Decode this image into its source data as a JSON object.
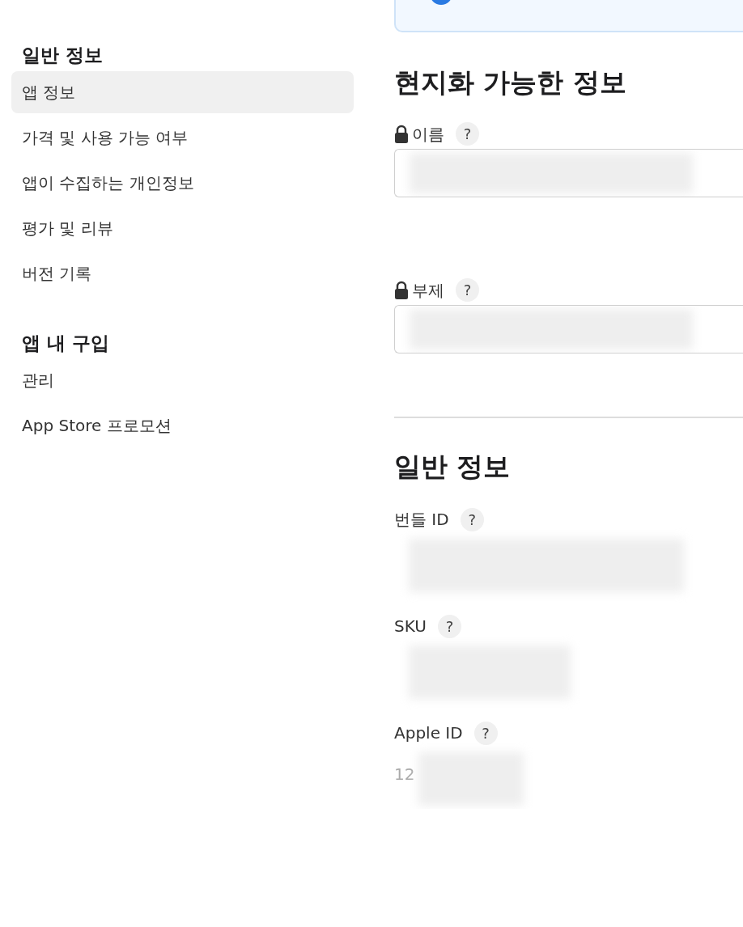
{
  "sidebar": {
    "sections": [
      {
        "heading": "일반 정보",
        "items": [
          {
            "label": "앱 정보",
            "selected": true
          },
          {
            "label": "가격 및 사용 가능 여부",
            "selected": false
          },
          {
            "label": "앱이 수집하는 개인정보",
            "selected": false
          },
          {
            "label": "평가 및 리뷰",
            "selected": false
          },
          {
            "label": "버전 기록",
            "selected": false
          }
        ]
      },
      {
        "heading": "앱 내 구입",
        "items": [
          {
            "label": "관리",
            "selected": false
          },
          {
            "label": "App Store 프로모션",
            "selected": false
          }
        ]
      }
    ]
  },
  "sections": [
    {
      "title": "현지화 가능한 정보",
      "fields": [
        {
          "label": "이름",
          "help": "?",
          "locked": true,
          "kind": "input",
          "redacted": true
        },
        {
          "label": "부제",
          "help": "?",
          "locked": true,
          "kind": "input",
          "redacted": true
        }
      ]
    },
    {
      "title": "일반 정보",
      "fields": [
        {
          "label": "번들 ID",
          "help": "?",
          "locked": false,
          "kind": "value",
          "redacted": true
        },
        {
          "label": "SKU",
          "help": "?",
          "locked": false,
          "kind": "value",
          "redacted": true
        },
        {
          "label": "Apple ID",
          "help": "?",
          "locked": false,
          "kind": "value",
          "value": "12",
          "redacted": true
        }
      ]
    }
  ]
}
